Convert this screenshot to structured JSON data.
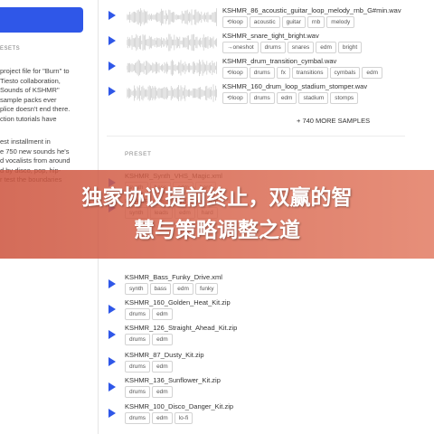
{
  "left_panel": {
    "presets_label": "ESETS",
    "description_1": "project file for \"Burn\" to\nTiesto collaboration,\nSounds of KSHMR\"\nsample packs ever\nplice doesn't end there.\nction tutorials have",
    "description_2": "est installment in\ne 750 new sounds he's\nd vocalists from around\nd by disco, pop, hip-\nr test the boundaries"
  },
  "samples": [
    {
      "name": "KSHMR_86_acoustic_guitar_loop_melody_rnb_G#min.wav",
      "tags": [
        "loop",
        "acoustic",
        "guitar",
        "rnb",
        "melody"
      ]
    },
    {
      "name": "KSHMR_snare_tight_bright.wav",
      "tags": [
        "oneshot",
        "drums",
        "snares",
        "edm",
        "bright"
      ]
    },
    {
      "name": "KSHMR_drum_transition_cymbal.wav",
      "tags": [
        "loop",
        "drums",
        "fx",
        "transitions",
        "cymbals",
        "edm"
      ]
    },
    {
      "name": "KSHMR_160_drum_loop_stadium_stomper.wav",
      "tags": [
        "loop",
        "drums",
        "edm",
        "stadium",
        "stomps"
      ]
    }
  ],
  "more_samples": "+ 740 MORE SAMPLES",
  "preset_header": "PRESET",
  "presets": [
    {
      "name": "KSHMR_Synth_VHS_Magic.xml",
      "tags": [
        "synth",
        "bass",
        "edm",
        "hard"
      ]
    },
    {
      "name": "KSHMR_Lead_Hard_Sync.xml",
      "tags": [
        "synth",
        "leads",
        "edm",
        "hard"
      ]
    },
    {
      "name": "KSHMR_Bass_Funky_Drive.xml",
      "tags": [
        "synth",
        "bass",
        "edm",
        "funky"
      ]
    },
    {
      "name": "KSHMR_160_Golden_Heat_Kit.zip",
      "tags": [
        "drums",
        "edm"
      ]
    },
    {
      "name": "KSHMR_126_Straight_Ahead_Kit.zip",
      "tags": [
        "drums",
        "edm"
      ]
    },
    {
      "name": "KSHMR_87_Dusty_Kit.zip",
      "tags": [
        "drums",
        "edm"
      ]
    },
    {
      "name": "KSHMR_136_Sunflower_Kit.zip",
      "tags": [
        "drums",
        "edm"
      ]
    },
    {
      "name": "KSHMR_100_Disco_Danger_Kit.zip",
      "tags": [
        "drums",
        "edm",
        "lo-fi"
      ]
    }
  ],
  "banner": {
    "line1": "独家协议提前终止，双赢的智",
    "line2": "慧与策略调整之道"
  },
  "colors": {
    "accent": "#2f57e8",
    "banner": "#d9634b"
  }
}
